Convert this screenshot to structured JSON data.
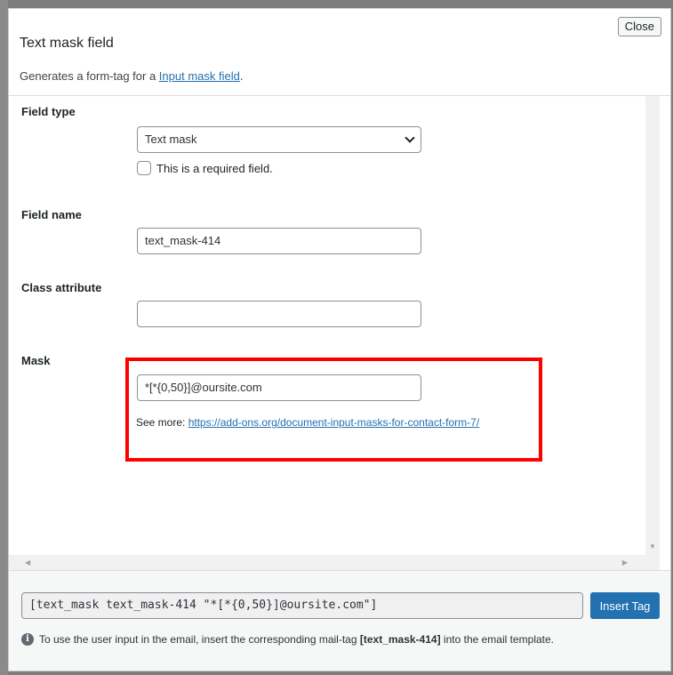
{
  "dialog": {
    "title": "Text mask field",
    "close_label": "Close",
    "description_prefix": "Generates a form-tag for a ",
    "description_link": "Input mask field",
    "description_suffix": "."
  },
  "fields": {
    "field_type": {
      "label": "Field type",
      "value": "Text mask",
      "required_label": "This is a required field.",
      "required_checked": false
    },
    "field_name": {
      "label": "Field name",
      "value": "text_mask-414"
    },
    "class_attribute": {
      "label": "Class attribute",
      "value": ""
    },
    "mask": {
      "label": "Mask",
      "value": "*[*{0,50}]@oursite.com",
      "see_more_label": "See more: ",
      "see_more_link": "https://add-ons.org/document-input-masks-for-contact-form-7/"
    }
  },
  "highlight_color": "#ff0000",
  "footer": {
    "tag_value": "[text_mask text_mask-414 \"*[*{0,50}]@oursite.com\"]",
    "insert_label": "Insert Tag",
    "info_prefix": "To use the user input in the email, insert the corresponding mail-tag ",
    "info_tag": "[text_mask-414]",
    "info_suffix": " into the email template."
  }
}
